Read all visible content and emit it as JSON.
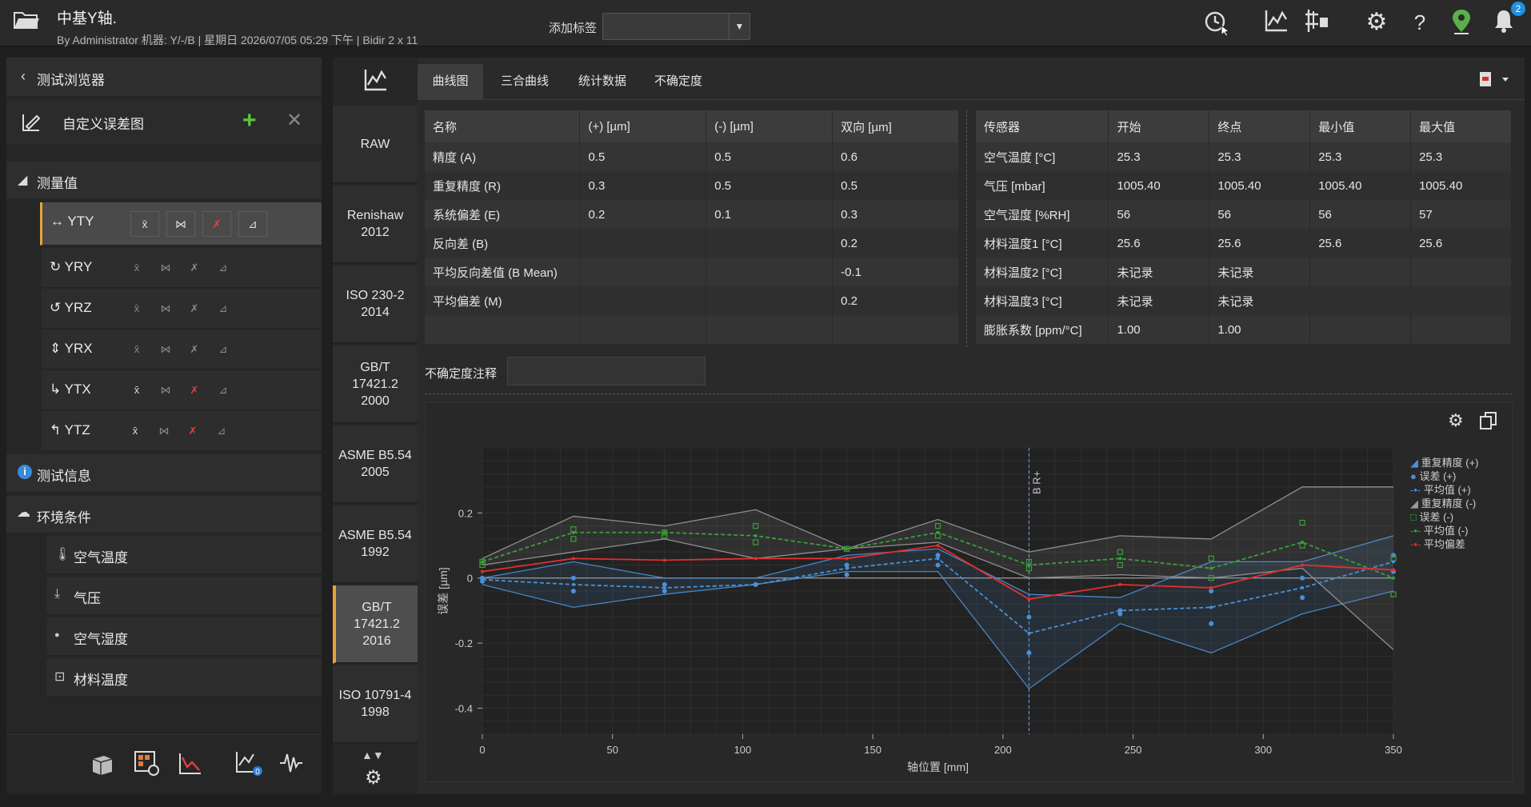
{
  "header": {
    "title": "中基Y轴.",
    "subtitle": "By Administrator  机器: Y/-/B  | 星期日 2026/07/05 05:29 下午  |  Bidir  2  x 11",
    "tag_label": "添加标签",
    "tag_value": "",
    "notification_count": "2",
    "icons": [
      "folder-icon",
      "clock-cursor-icon",
      "chart-line-icon",
      "axis-icon",
      "gear-icon",
      "help-icon",
      "location-icon",
      "bell-icon"
    ]
  },
  "browser": {
    "back_label": "测试浏览器",
    "plot_name": "自定义误差图",
    "measurements_label": "测量值",
    "measurements": [
      {
        "name": "YTY",
        "icon": "↔"
      },
      {
        "name": "YRY",
        "icon": "↻"
      },
      {
        "name": "YRZ",
        "icon": "↺"
      },
      {
        "name": "YRX",
        "icon": "⇕"
      },
      {
        "name": "YTX",
        "icon": "↳"
      },
      {
        "name": "YTZ",
        "icon": "↰"
      }
    ],
    "test_info_label": "测试信息",
    "env_label": "环境条件",
    "env_items": [
      {
        "label": "空气温度",
        "icon": "🌡"
      },
      {
        "label": "气压",
        "icon": "⤓"
      },
      {
        "label": "空气湿度",
        "icon": "●"
      },
      {
        "label": "材料温度",
        "icon": "⊡"
      }
    ]
  },
  "standards": [
    {
      "label": "RAW"
    },
    {
      "label": "Renishaw\n2012"
    },
    {
      "label": "ISO 230-2\n2014"
    },
    {
      "label": "GB/T\n17421.2\n2000"
    },
    {
      "label": "ASME B5.54\n2005"
    },
    {
      "label": "ASME B5.54\n1992"
    },
    {
      "label": "GB/T\n17421.2\n2016"
    },
    {
      "label": "ISO 10791-4\n1998"
    }
  ],
  "tabs": [
    "曲线图",
    "三合曲线",
    "统计数据",
    "不确定度"
  ],
  "results_table": {
    "headers": [
      "名称",
      "(+) [µm]",
      "(-) [µm]",
      "双向 [µm]"
    ],
    "rows": [
      [
        "精度 (A)",
        "0.5",
        "0.5",
        "0.6"
      ],
      [
        "重复精度 (R)",
        "0.3",
        "0.5",
        "0.5"
      ],
      [
        "系统偏差 (E)",
        "0.2",
        "0.1",
        "0.3"
      ],
      [
        "反向差 (B)",
        "",
        "",
        "0.2"
      ],
      [
        "平均反向差值 (B Mean)",
        "",
        "",
        "-0.1"
      ],
      [
        "平均偏差 (M)",
        "",
        "",
        "0.2"
      ]
    ]
  },
  "sensor_table": {
    "headers": [
      "传感器",
      "开始",
      "终点",
      "最小值",
      "最大值"
    ],
    "rows": [
      [
        "空气温度 [°C]",
        "25.3",
        "25.3",
        "25.3",
        "25.3"
      ],
      [
        "气压 [mbar]",
        "1005.40",
        "1005.40",
        "1005.40",
        "1005.40"
      ],
      [
        "空气湿度 [%RH]",
        "56",
        "56",
        "56",
        "57"
      ],
      [
        "材料温度1 [°C]",
        "25.6",
        "25.6",
        "25.6",
        "25.6"
      ],
      [
        "材料温度2 [°C]",
        "未记录",
        "未记录",
        "",
        ""
      ],
      [
        "材料温度3 [°C]",
        "未记录",
        "未记录",
        "",
        ""
      ],
      [
        "膨胀系数 [ppm/°C]",
        "1.00",
        "1.00",
        "",
        ""
      ]
    ]
  },
  "uncertainty": {
    "label": "不确定度注释",
    "value": ""
  },
  "chart_data": {
    "type": "line",
    "xlabel": "轴位置 [mm]",
    "ylabel": "误差 [µm]",
    "xlim": [
      0,
      350
    ],
    "ylim": [
      -0.48,
      0.4
    ],
    "xticks": [
      0,
      50,
      100,
      150,
      200,
      250,
      300,
      350
    ],
    "yticks": [
      -0.4,
      -0.2,
      0,
      0.2
    ],
    "x": [
      0,
      35,
      70,
      105,
      140,
      175,
      210,
      245,
      280,
      315,
      350
    ],
    "annotation": {
      "x": 210,
      "label": "B  R+"
    },
    "legend_placement": "right",
    "series": [
      {
        "name": "重复精度 (+)",
        "color": "#4a90d9",
        "role": "band",
        "upper": [
          0.0,
          0.05,
          0.0,
          0.0,
          0.07,
          0.09,
          -0.05,
          -0.06,
          0.05,
          0.05,
          0.13
        ],
        "lower": [
          -0.02,
          -0.09,
          -0.05,
          -0.02,
          0.02,
          0.02,
          -0.34,
          -0.14,
          -0.23,
          -0.11,
          -0.04
        ]
      },
      {
        "name": "误差 (+)",
        "color": "#4a90d9",
        "role": "points",
        "values": [
          0.0,
          0.0,
          -0.02,
          -0.02,
          0.04,
          0.07,
          -0.12,
          -0.1,
          -0.04,
          0.0,
          0.07
        ],
        "values2": [
          -0.01,
          -0.04,
          -0.04,
          -0.02,
          0.01,
          0.04,
          -0.23,
          -0.11,
          -0.14,
          -0.06,
          0.02
        ]
      },
      {
        "name": "平均值 (+)",
        "color": "#4a90d9",
        "role": "line",
        "values": [
          -0.005,
          -0.02,
          -0.03,
          -0.02,
          0.03,
          0.06,
          -0.17,
          -0.1,
          -0.09,
          -0.03,
          0.05
        ]
      },
      {
        "name": "重复精度 (-)",
        "color": "#9a9a9a",
        "role": "band",
        "upper": [
          0.06,
          0.19,
          0.16,
          0.21,
          0.09,
          0.18,
          0.08,
          0.13,
          0.12,
          0.28,
          0.28
        ],
        "lower": [
          0.04,
          0.08,
          0.12,
          0.06,
          0.09,
          0.11,
          0.0,
          0.01,
          0.0,
          0.03,
          -0.22
        ]
      },
      {
        "name": "误差 (-)",
        "color": "#3aa03a",
        "role": "points",
        "values": [
          0.05,
          0.15,
          0.14,
          0.16,
          0.09,
          0.16,
          0.05,
          0.08,
          0.06,
          0.17,
          0.06
        ],
        "values2": [
          0.04,
          0.12,
          0.13,
          0.11,
          0.09,
          0.13,
          0.03,
          0.04,
          0.0,
          0.1,
          -0.05
        ]
      },
      {
        "name": "平均值 (-)",
        "color": "#3aa03a",
        "role": "line",
        "values": [
          0.05,
          0.14,
          0.14,
          0.13,
          0.09,
          0.14,
          0.04,
          0.06,
          0.03,
          0.11,
          0.0
        ]
      },
      {
        "name": "平均偏差",
        "color": "#e03030",
        "role": "line",
        "values": [
          0.02,
          0.06,
          0.055,
          0.06,
          0.06,
          0.1,
          -0.065,
          -0.02,
          -0.03,
          0.04,
          0.025
        ]
      }
    ]
  }
}
